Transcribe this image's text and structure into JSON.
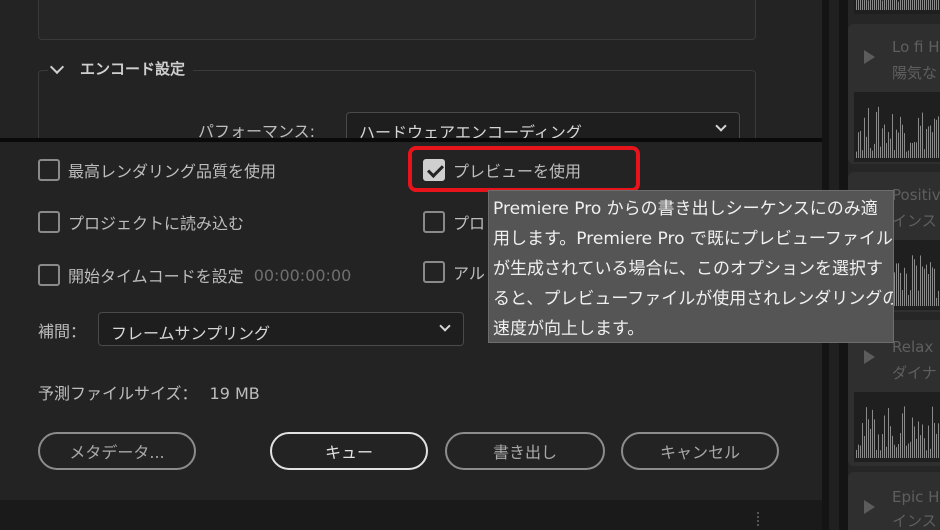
{
  "encode_section": {
    "header": "エンコード設定",
    "performance_label": "パフォーマンス:",
    "performance_value": "ハードウェアエンコーディング"
  },
  "checkboxes": {
    "max_render_quality": {
      "label": "最高レンダリング品質を使用",
      "checked": false
    },
    "use_previews": {
      "label": "プレビューを使用",
      "checked": true
    },
    "import_into_project": {
      "label": "プロジェクトに読み込む",
      "checked": false
    },
    "col2_row2": {
      "label": "プロ",
      "checked": false
    },
    "set_start_timecode": {
      "label": "開始タイムコードを設定",
      "checked": false,
      "timecode": "00:00:00:00"
    },
    "col2_row3": {
      "label": "アル",
      "checked": false
    }
  },
  "interpolation": {
    "label": "補間：",
    "value": "フレームサンプリング"
  },
  "file_size": {
    "label": "予測ファイルサイズ：",
    "value": "19 MB"
  },
  "buttons": {
    "metadata": "メタデータ...",
    "queue": "キュー",
    "export": "書き出し",
    "cancel": "キャンセル"
  },
  "tooltip": {
    "lines": [
      "Premiere Pro からの書き出しシーケンスにのみ適",
      "用します。Premiere Pro で既にプレビューファイル",
      "が生成されている場合に、このオプションを選択す",
      "ると、プレビューファイルが使用されレンダリングの",
      "速度が向上します。"
    ]
  },
  "right_panel": {
    "tracks": [
      {
        "line1": "Lo fi H",
        "line2": "陽気な"
      },
      {
        "line1": "Positiv",
        "line2": "インス"
      },
      {
        "line1": "Relax",
        "line2": "ダイナ"
      },
      {
        "line1": "Epic H",
        "line2": "インス"
      }
    ]
  },
  "colors": {
    "dialog_bg": "#232323",
    "highlight": "#e8141b",
    "tooltip_bg": "#555555",
    "primary_button_border": "#e2e2e2"
  }
}
